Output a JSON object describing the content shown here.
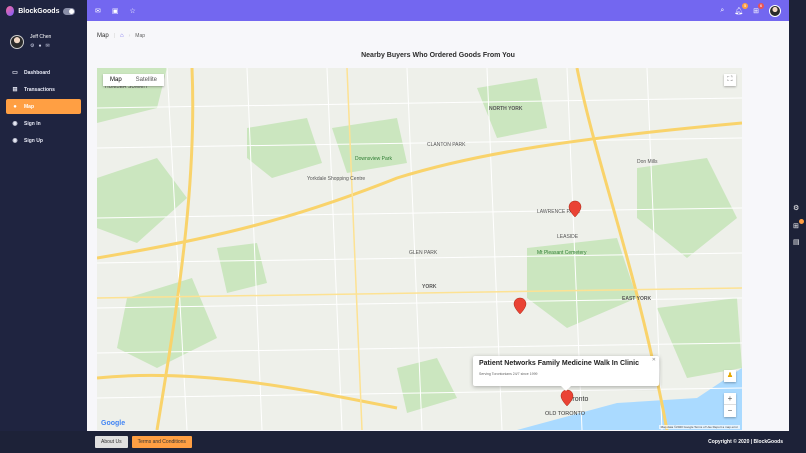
{
  "brand": {
    "name": "BlockGoods"
  },
  "user": {
    "name": "Jeff Chen"
  },
  "nav": [
    {
      "label": "Dashboard",
      "icon": "home-icon",
      "glyph": "▭"
    },
    {
      "label": "Transactions",
      "icon": "cart-icon",
      "glyph": "🛒"
    },
    {
      "label": "Map",
      "icon": "map-pin-icon",
      "glyph": "⚲",
      "active": true
    },
    {
      "label": "Sign In",
      "icon": "person-icon",
      "glyph": "👤"
    },
    {
      "label": "Sign Up",
      "icon": "add-person-icon",
      "glyph": "👤"
    }
  ],
  "topbar": {
    "icons": [
      "mail-icon",
      "calendar-icon",
      "star-icon"
    ],
    "notification_count": "5",
    "cart_count": "6"
  },
  "breadcrumb": {
    "title": "Map",
    "current": "Map"
  },
  "page": {
    "title": "Nearby Buyers Who Ordered Goods From You"
  },
  "map": {
    "types": [
      "Map",
      "Satellite"
    ],
    "selected_type": "Map",
    "info_window": {
      "title": "Patient Networks Family Medicine Walk In Clinic",
      "subtitle": "Serving Torontonians 24/7 since 1999"
    },
    "labels": [
      "NORTH YORK",
      "Downsview Park",
      "LAWRENCE PARK",
      "YORK",
      "EAST YORK",
      "Toronto",
      "OLD TORONTO",
      "CLANTON PARK",
      "GLEN PARK",
      "LEASIDE",
      "HUMBER SUMMIT",
      "Mt Pleasant Cemetery",
      "Don Mills",
      "Yorkdale Shopping Centre"
    ],
    "attribution": "Map data ©2020 Google  Terms of Use  Report a map error",
    "google": "Google"
  },
  "footer": {
    "about": "About Us",
    "terms": "Terms and Conditions",
    "copyright": "Copyright © 2020 | BlockGoods"
  }
}
